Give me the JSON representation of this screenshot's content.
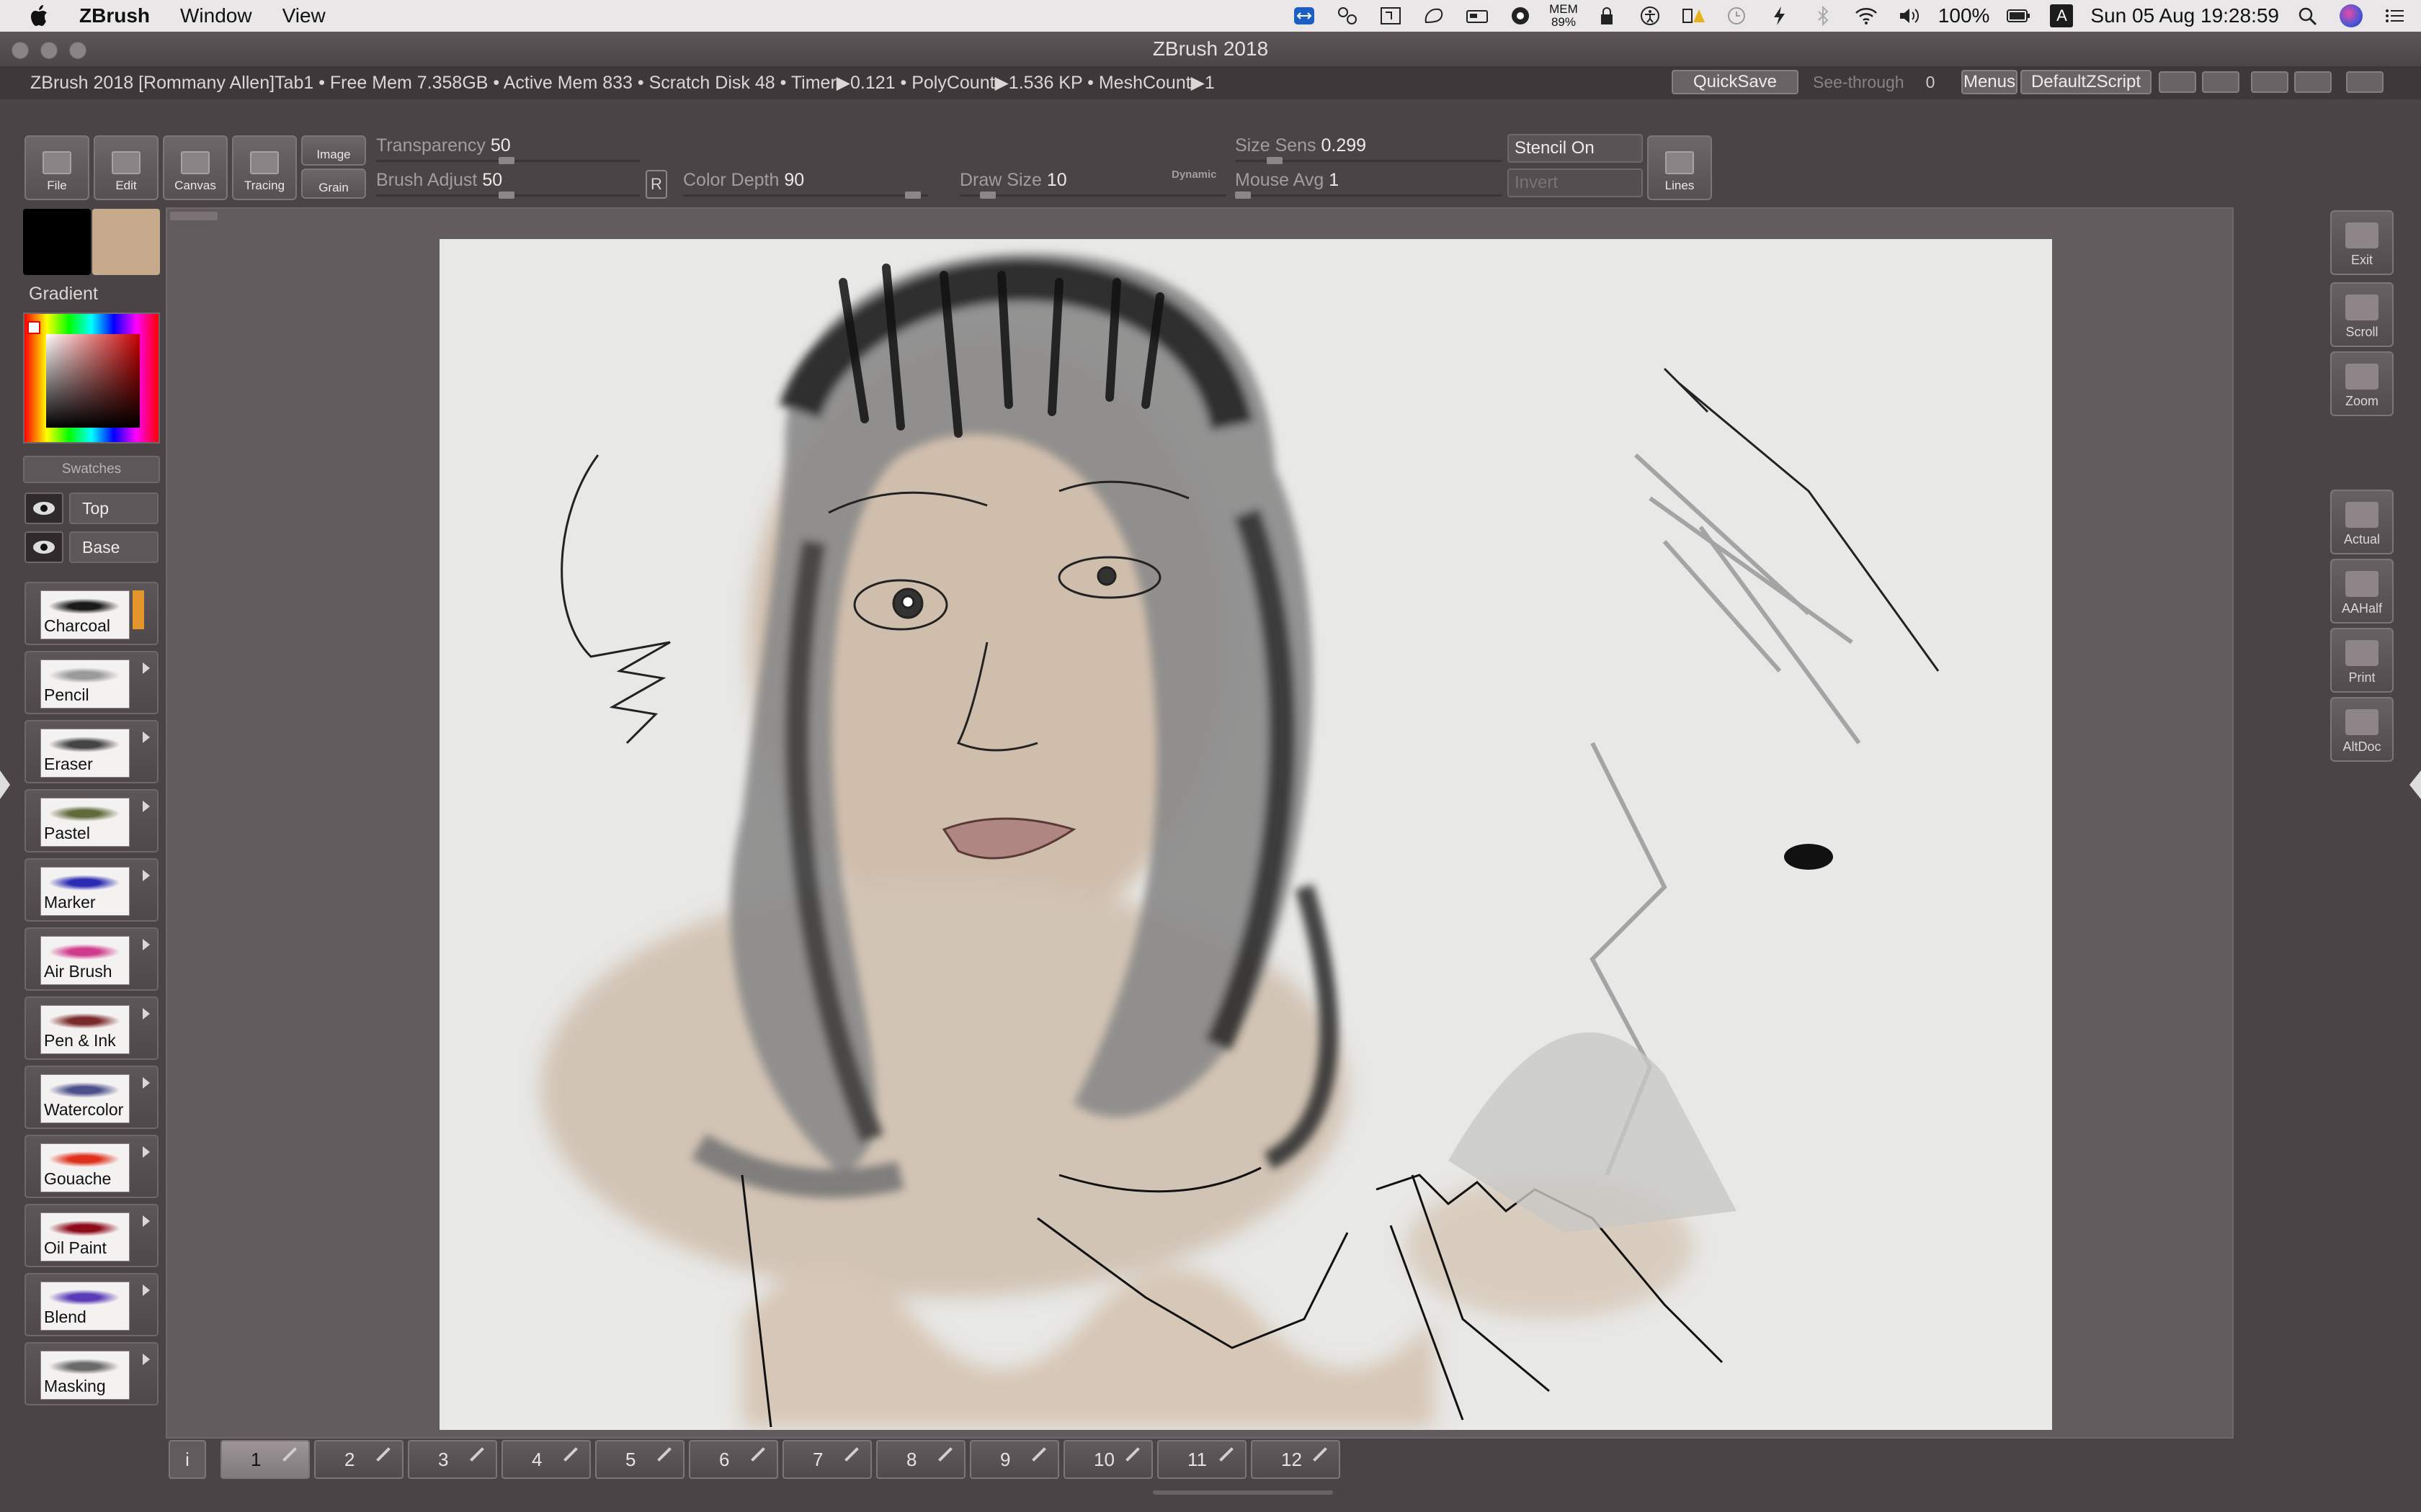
{
  "menubar": {
    "app": "ZBrush",
    "menus": [
      "Window",
      "View"
    ],
    "mem_top": "MEM",
    "mem_value": "89%",
    "battery": "100%",
    "datetime": "Sun 05 Aug  19:28:59",
    "input_badge": "A"
  },
  "window": {
    "title": "ZBrush 2018"
  },
  "infobar": {
    "text": "ZBrush 2018 [Rommany Allen]Tab1    • Free Mem 7.358GB • Active Mem 833 • Scratch Disk 48 •   Timer▶0.121 • PolyCount▶1.536 KP  • MeshCount▶1",
    "quicksave": "QuickSave",
    "seethrough_label": "See-through",
    "seethrough_value": "0",
    "menus": "Menus",
    "script": "DefaultZScript"
  },
  "toolbar": {
    "file": "File",
    "edit": "Edit",
    "canvas": "Canvas",
    "tracing": "Tracing",
    "image": "Image",
    "grain": "Grain",
    "transparency_label": "Transparency",
    "transparency_value": "50",
    "brush_adjust_label": "Brush Adjust",
    "brush_adjust_value": "50",
    "r_button": "R",
    "color_depth_label": "Color Depth",
    "color_depth_value": "90",
    "draw_size_label": "Draw Size",
    "draw_size_value": "10",
    "dynamic": "Dynamic",
    "size_sens_label": "Size Sens",
    "size_sens_value": "0.299",
    "mouse_avg_label": "Mouse Avg",
    "mouse_avg_value": "1",
    "stencil_on": "Stencil On",
    "invert": "Invert",
    "lines": "Lines"
  },
  "left": {
    "primary_color": "#000000",
    "secondary_color": "#c7a98b",
    "gradient_label": "Gradient",
    "swatches": "Swatches",
    "layers": [
      "Top",
      "Base"
    ],
    "brushes": [
      {
        "name": "Charcoal",
        "color": "#1a1a1a"
      },
      {
        "name": "Pencil",
        "color": "#9a9a9a"
      },
      {
        "name": "Eraser",
        "color": "#444444"
      },
      {
        "name": "Pastel",
        "color": "#5f6b3a"
      },
      {
        "name": "Marker",
        "color": "#2a2ab4"
      },
      {
        "name": "Air Brush",
        "color": "#d03a8c"
      },
      {
        "name": "Pen & Ink",
        "color": "#7a2a2a"
      },
      {
        "name": "Watercolor",
        "color": "#4d4f8c"
      },
      {
        "name": "Gouache",
        "color": "#e0301c"
      },
      {
        "name": "Oil Paint",
        "color": "#8c0a1a"
      },
      {
        "name": "Blend",
        "color": "#5a3ab8"
      },
      {
        "name": "Masking",
        "color": "#6a6a6a"
      }
    ]
  },
  "right": {
    "buttons": [
      "Exit",
      "Scroll",
      "Zoom",
      "Actual",
      "AAHalf",
      "Print",
      "AltDoc"
    ]
  },
  "bottom": {
    "info": "i",
    "tabs": [
      "1",
      "2",
      "3",
      "4",
      "5",
      "6",
      "7",
      "8",
      "9",
      "10",
      "11",
      "12"
    ]
  }
}
